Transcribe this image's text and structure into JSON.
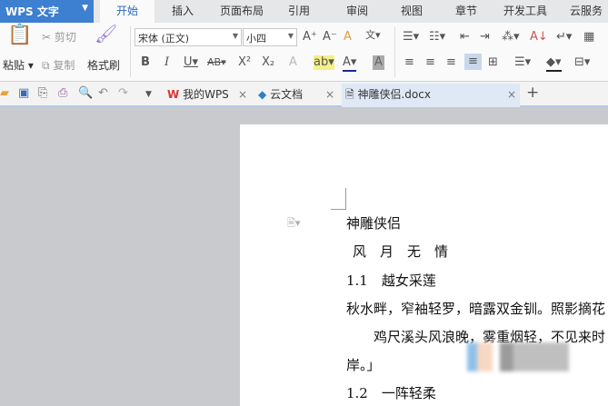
{
  "app": {
    "title": "WPS 文字"
  },
  "menu_tabs": [
    "开始",
    "插入",
    "页面布局",
    "引用",
    "审阅",
    "视图",
    "章节",
    "开发工具",
    "云服务"
  ],
  "ribbon": {
    "paste": "粘贴",
    "cut": "剪切",
    "copy": "复制",
    "format_painter": "格式刷",
    "font": "宋体 (正文)",
    "size": "小四"
  },
  "doc_tabs": [
    {
      "label": "我的WPS"
    },
    {
      "label": "云文档"
    },
    {
      "label": "神雕侠侣.docx"
    }
  ],
  "document": {
    "lines": [
      "神雕侠侣",
      "风　月　无　情",
      "1.1　越女采莲",
      "秋水畔，窄袖轻罗，暗露双金钏。照影摘花",
      "　　鸡尺溪头风浪晚，雾重烟轻，不见来时",
      "岸。」",
      "1.2　一阵轻柔"
    ]
  },
  "colors": {
    "accent": "#3d7fd0",
    "active_tab": "#2a6ab8"
  }
}
